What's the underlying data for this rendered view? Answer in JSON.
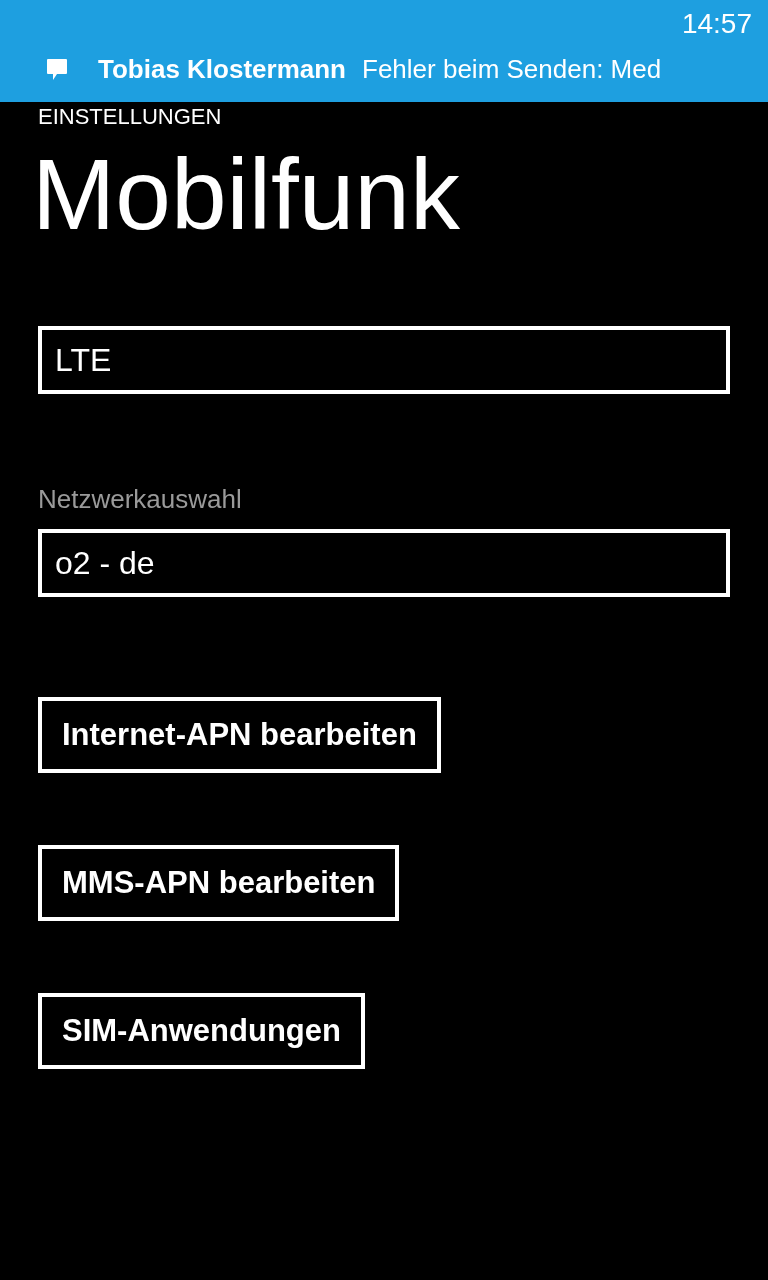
{
  "status_bar": {
    "time": "14:57"
  },
  "notification": {
    "sender": "Tobias Klostermann",
    "message": "Fehler beim Senden: Med"
  },
  "header": {
    "section": "EINSTELLUNGEN",
    "title": "Mobilfunk"
  },
  "items": [
    {
      "kind": "picker",
      "value": "LTE"
    },
    {
      "kind": "picker",
      "label": "Netzwerkauswahl",
      "value": "o2 - de"
    },
    {
      "kind": "button",
      "label": "Internet-APN bearbeiten"
    },
    {
      "kind": "button",
      "label": "MMS-APN bearbeiten"
    },
    {
      "kind": "button",
      "label": "SIM-Anwendungen"
    }
  ]
}
